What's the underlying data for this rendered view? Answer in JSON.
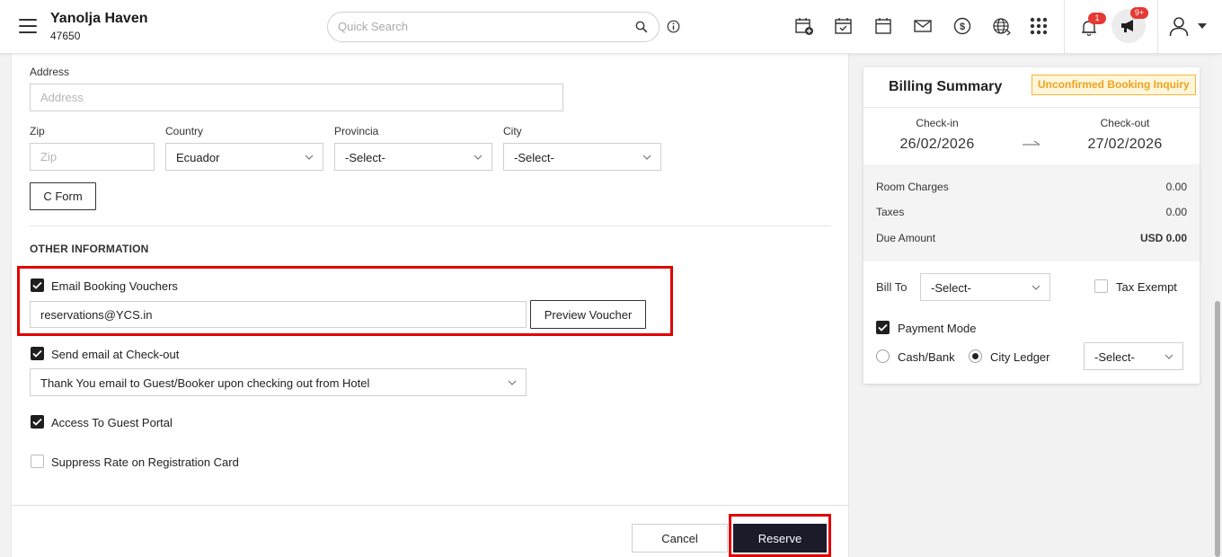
{
  "header": {
    "brand_name": "Yanolja Haven",
    "brand_code": "47650",
    "search_placeholder": "Quick Search",
    "notification_count": "1",
    "announcement_count": "9+"
  },
  "form": {
    "address_label": "Address",
    "address_placeholder": "Address",
    "zip_label": "Zip",
    "zip_placeholder": "Zip",
    "country_label": "Country",
    "country_value": "Ecuador",
    "provincia_label": "Provincia",
    "provincia_value": "-Select-",
    "city_label": "City",
    "city_value": "-Select-",
    "cform_label": "C Form"
  },
  "other_info": {
    "title": "OTHER INFORMATION",
    "email_vouchers_label": "Email Booking Vouchers",
    "email_vouchers_checked": true,
    "email_value": "reservations@YCS.in",
    "preview_voucher_label": "Preview Voucher",
    "send_checkout_label": "Send email at Check-out",
    "send_checkout_checked": true,
    "checkout_template_value": "Thank You email to Guest/Booker upon checking out from Hotel",
    "guest_portal_label": "Access To Guest Portal",
    "guest_portal_checked": true,
    "suppress_rate_label": "Suppress Rate on Registration Card",
    "suppress_rate_checked": false
  },
  "footer": {
    "cancel_label": "Cancel",
    "reserve_label": "Reserve"
  },
  "billing": {
    "title": "Billing Summary",
    "status": "Unconfirmed Booking Inquiry",
    "checkin_label": "Check-in",
    "checkin_date": "26/02/2026",
    "checkout_label": "Check-out",
    "checkout_date": "27/02/2026",
    "room_charges_label": "Room Charges",
    "room_charges_value": "0.00",
    "taxes_label": "Taxes",
    "taxes_value": "0.00",
    "due_label": "Due Amount",
    "due_value": "USD 0.00",
    "bill_to_label": "Bill To",
    "bill_to_value": "-Select-",
    "tax_exempt_label": "Tax Exempt",
    "payment_mode_label": "Payment Mode",
    "cash_bank_label": "Cash/Bank",
    "city_ledger_label": "City Ledger",
    "ledger_select_value": "-Select-"
  },
  "colors": {
    "highlight": "#e00000",
    "reserve_bg": "#1c1b2a",
    "badge_red": "#e53935",
    "status_text": "#f0a21f"
  }
}
